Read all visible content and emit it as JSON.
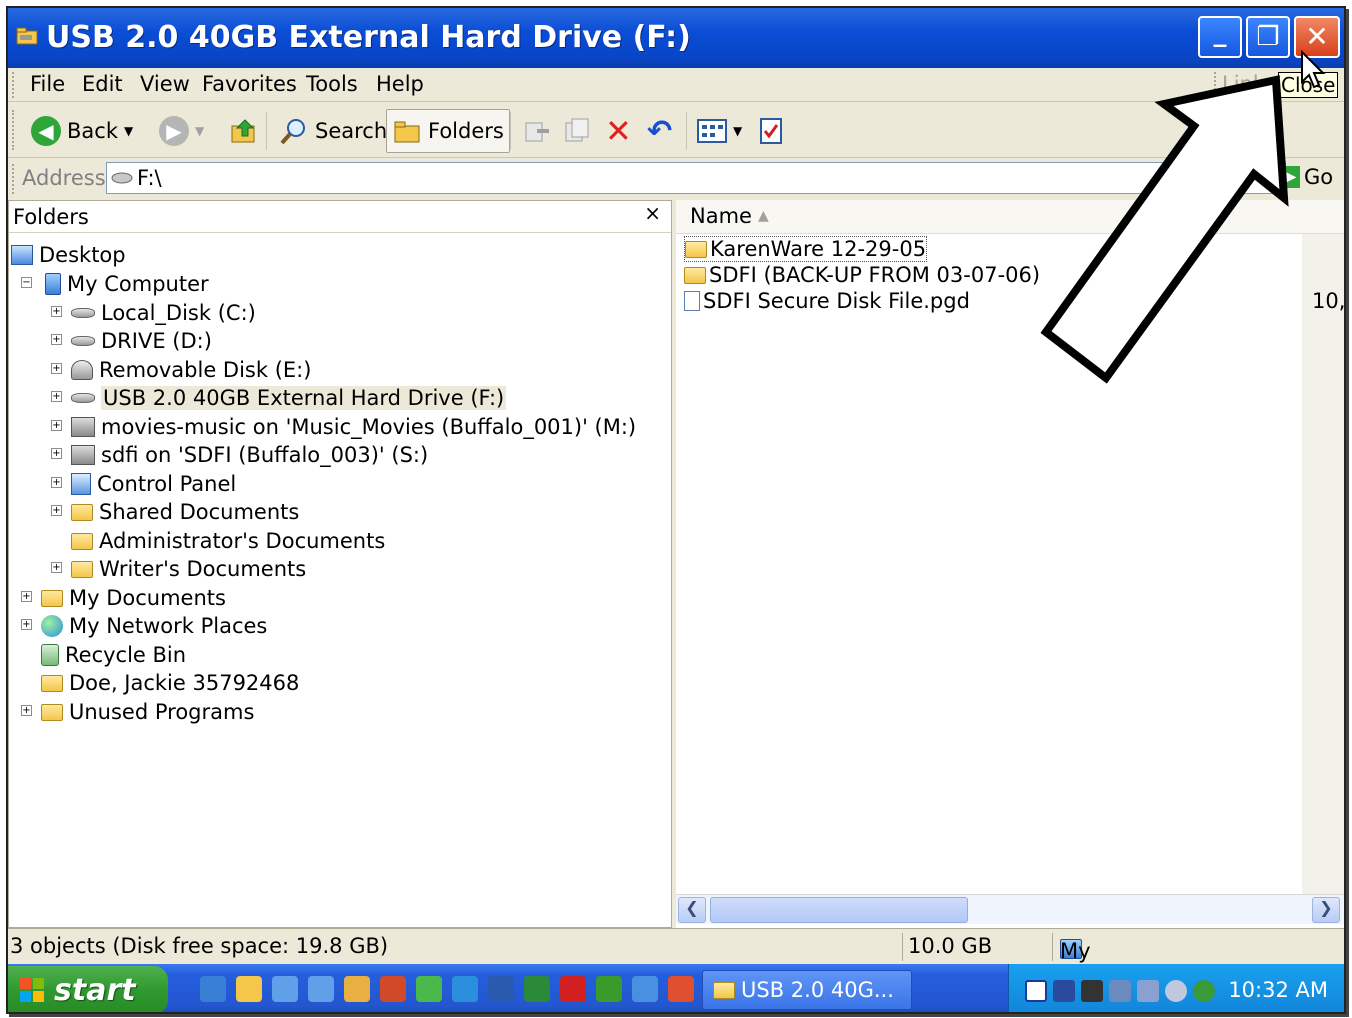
{
  "window": {
    "title": "USB 2.0 40GB External Hard Drive (F:)",
    "tooltip": "Close",
    "min_glyph": "_",
    "max_glyph": "❐",
    "close_glyph": "✕"
  },
  "menu": {
    "items": [
      "File",
      "Edit",
      "View",
      "Favorites",
      "Tools",
      "Help"
    ],
    "links": "Links"
  },
  "toolbar": {
    "back_label": "Back",
    "search_label": "Search",
    "folders_label": "Folders"
  },
  "address": {
    "label": "Address",
    "value": "F:\\",
    "go_label": "Go"
  },
  "folders_pane": {
    "title": "Folders",
    "close_glyph": "×",
    "tree": [
      {
        "label": "Desktop",
        "icon": "desktop-icon"
      },
      {
        "label": "My Computer",
        "icon": "my-computer-icon"
      },
      {
        "label": "Local_Disk (C:)",
        "icon": "drive-icon"
      },
      {
        "label": "DRIVE (D:)",
        "icon": "drive-icon"
      },
      {
        "label": "Removable Disk (E:)",
        "icon": "removable-disk-icon"
      },
      {
        "label": "USB 2.0 40GB External Hard Drive (F:)",
        "icon": "drive-icon"
      },
      {
        "label": "movies-music on 'Music_Movies (Buffalo_001)' (M:)",
        "icon": "network-drive-icon"
      },
      {
        "label": "sdfi on 'SDFI (Buffalo_003)' (S:)",
        "icon": "network-drive-icon"
      },
      {
        "label": "Control Panel",
        "icon": "control-panel-icon"
      },
      {
        "label": "Shared Documents",
        "icon": "folder-icon"
      },
      {
        "label": "Administrator's Documents",
        "icon": "folder-icon"
      },
      {
        "label": "Writer's Documents",
        "icon": "folder-icon"
      },
      {
        "label": "My Documents",
        "icon": "my-documents-icon"
      },
      {
        "label": "My Network Places",
        "icon": "network-places-icon"
      },
      {
        "label": "Recycle Bin",
        "icon": "recycle-bin-icon"
      },
      {
        "label": "Doe, Jackie 35792468",
        "icon": "folder-icon"
      },
      {
        "label": "Unused Programs",
        "icon": "folder-icon"
      }
    ]
  },
  "files": {
    "column_name": "Name",
    "items": [
      {
        "name": "KarenWare 12-29-05",
        "icon": "folder-icon"
      },
      {
        "name": "SDFI (BACK-UP FROM 03-07-06)",
        "icon": "folder-icon"
      },
      {
        "name": "SDFI Secure Disk File.pgd",
        "icon": "file-icon"
      }
    ],
    "partial_size": "10,"
  },
  "status": {
    "objects": "3 objects (Disk free space: 19.8 GB)",
    "size": "10.0 GB",
    "zone": "My Computer"
  },
  "taskbar": {
    "start_label": "start",
    "task_label": "USB 2.0 40G...",
    "clock": "10:32 AM"
  }
}
